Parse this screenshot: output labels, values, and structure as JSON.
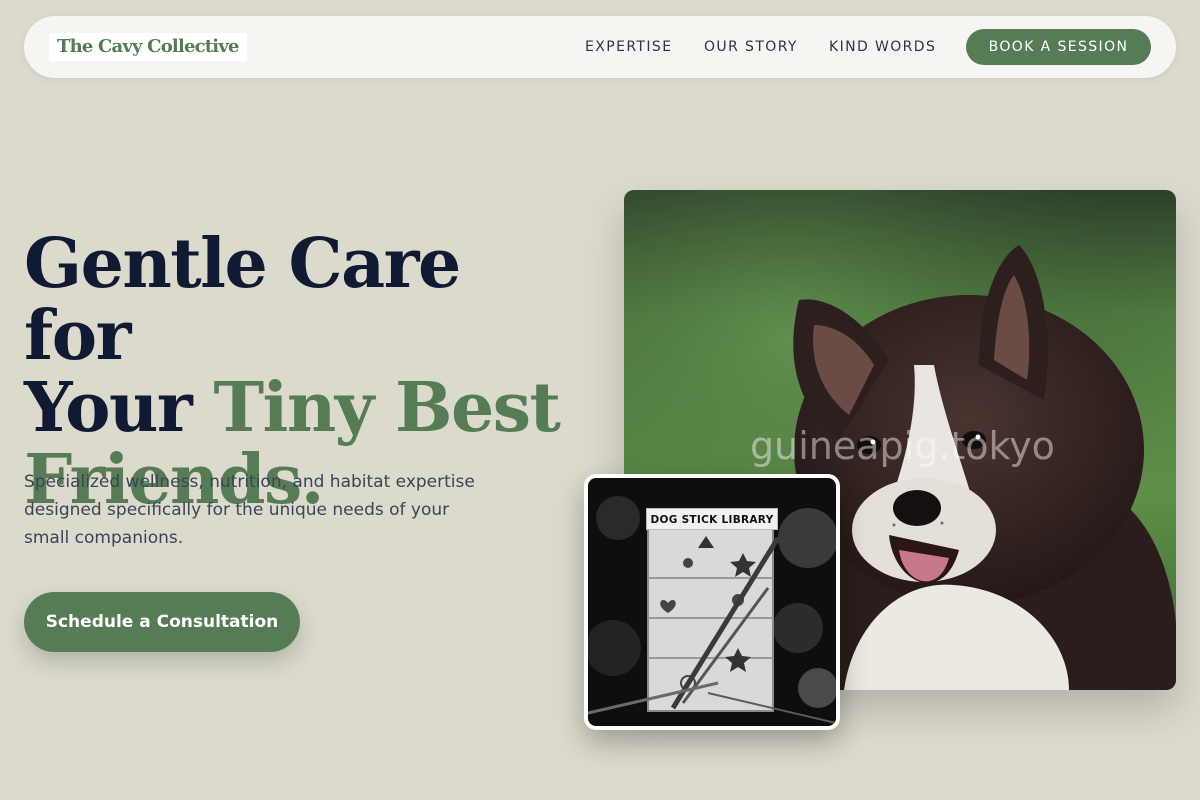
{
  "brand": {
    "name": "The Cavy Collective",
    "color": "#567c56"
  },
  "nav": {
    "links": [
      "EXPERTISE",
      "OUR STORY",
      "KIND WORDS"
    ],
    "cta_label": "BOOK A SESSION"
  },
  "hero": {
    "headline_line1": "Gentle Care for",
    "headline_line2_plain": "Your ",
    "headline_line2_accent": "Tiny Best",
    "headline_line3_accent": "Friends.",
    "subtext": "Specialized wellness, nutrition, and habitat expertise designed specifically for the unique needs of your small companions.",
    "cta_label": "Schedule a Consultation"
  },
  "images": {
    "main_watermark": "guineapig.tokyo",
    "inset_sign": "DOG STICK LIBRARY"
  },
  "colors": {
    "background": "#dcd9cd",
    "heading": "#111a33",
    "accent": "#567c56",
    "body_text": "#3b4557"
  }
}
